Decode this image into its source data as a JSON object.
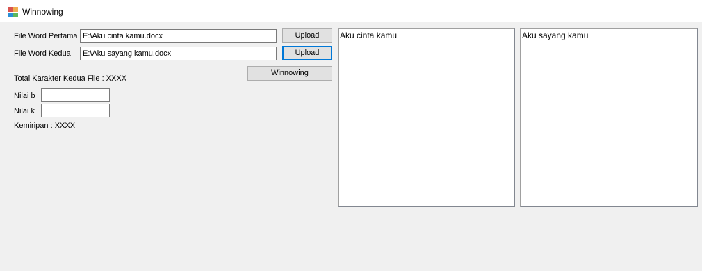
{
  "window": {
    "title": "Winnowing",
    "icon": "form-icon"
  },
  "form": {
    "file1_label": "File Word Pertama",
    "file1_value": "E:\\Aku cinta kamu.docx",
    "file2_label": "File Word Kedua",
    "file2_value": "E:\\Aku sayang kamu.docx",
    "upload1_label": "Upload",
    "upload2_label": "Upload",
    "winnowing_label": "Winnowing",
    "total_chars_label": "Total Karakter Kedua File : XXXX",
    "nilai_b_label": "Nilai b",
    "nilai_b_value": "",
    "nilai_k_label": "Nilai k",
    "nilai_k_value": "",
    "kemiripan_label": "Kemiripan :  XXXX"
  },
  "panels": {
    "left_text": "Aku cinta kamu",
    "right_text": "Aku sayang kamu"
  }
}
